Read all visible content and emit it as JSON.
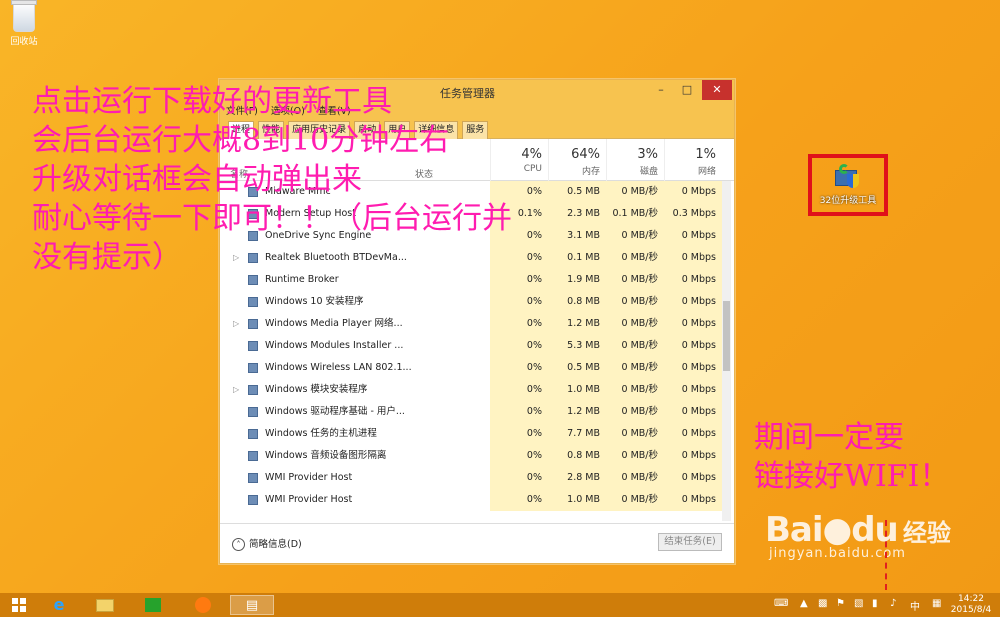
{
  "desktop": {
    "recycle_bin_label": "回收站",
    "updater_label": "32位升级工具"
  },
  "annotations": {
    "left_lines": [
      "点击运行下载好的更新工具",
      "会后台运行大概8到10分钟左右",
      "升级对话框会自动弹出来",
      "耐心等待一下即可！！（后台运行并",
      "没有提示）"
    ],
    "right_lines": [
      "期间一定要",
      "链接好WIFI！"
    ]
  },
  "task_manager": {
    "title": "任务管理器",
    "menu": [
      "文件(F)",
      "选项(O)",
      "查看(V)"
    ],
    "tabs": [
      "进程",
      "性能",
      "应用历史记录",
      "启动",
      "用户",
      "详细信息",
      "服务"
    ],
    "active_tab": "进程",
    "columns": {
      "name": "名称",
      "status": "状态",
      "cpu": {
        "pct": "4%",
        "label": "CPU"
      },
      "memory": {
        "pct": "64%",
        "label": "内存"
      },
      "disk": {
        "pct": "3%",
        "label": "磁盘"
      },
      "network": {
        "pct": "1%",
        "label": "网络"
      }
    },
    "processes": [
      {
        "name": "Midware Mmc",
        "expand": "",
        "cpu": "0%",
        "mem": "0.5 MB",
        "disk": "0 MB/秒",
        "net": "0 Mbps"
      },
      {
        "name": "Modern Setup Host",
        "expand": "",
        "cpu": "0.1%",
        "mem": "2.3 MB",
        "disk": "0.1 MB/秒",
        "net": "0.3 Mbps"
      },
      {
        "name": "OneDrive Sync Engine",
        "expand": "",
        "cpu": "0%",
        "mem": "3.1 MB",
        "disk": "0 MB/秒",
        "net": "0 Mbps"
      },
      {
        "name": "Realtek Bluetooth BTDevMa...",
        "expand": "▷",
        "cpu": "0%",
        "mem": "0.1 MB",
        "disk": "0 MB/秒",
        "net": "0 Mbps"
      },
      {
        "name": "Runtime Broker",
        "expand": "",
        "cpu": "0%",
        "mem": "1.9 MB",
        "disk": "0 MB/秒",
        "net": "0 Mbps"
      },
      {
        "name": "Windows 10 安装程序",
        "expand": "",
        "cpu": "0%",
        "mem": "0.8 MB",
        "disk": "0 MB/秒",
        "net": "0 Mbps"
      },
      {
        "name": "Windows Media Player 网络...",
        "expand": "▷",
        "cpu": "0%",
        "mem": "1.2 MB",
        "disk": "0 MB/秒",
        "net": "0 Mbps"
      },
      {
        "name": "Windows Modules Installer ...",
        "expand": "",
        "cpu": "0%",
        "mem": "5.3 MB",
        "disk": "0 MB/秒",
        "net": "0 Mbps"
      },
      {
        "name": "Windows Wireless LAN 802.1...",
        "expand": "",
        "cpu": "0%",
        "mem": "0.5 MB",
        "disk": "0 MB/秒",
        "net": "0 Mbps"
      },
      {
        "name": "Windows 模块安装程序",
        "expand": "▷",
        "cpu": "0%",
        "mem": "1.0 MB",
        "disk": "0 MB/秒",
        "net": "0 Mbps"
      },
      {
        "name": "Windows 驱动程序基础 - 用户...",
        "expand": "",
        "cpu": "0%",
        "mem": "1.2 MB",
        "disk": "0 MB/秒",
        "net": "0 Mbps"
      },
      {
        "name": "Windows 任务的主机进程",
        "expand": "",
        "cpu": "0%",
        "mem": "7.7 MB",
        "disk": "0 MB/秒",
        "net": "0 Mbps"
      },
      {
        "name": "Windows 音频设备图形隔离",
        "expand": "",
        "cpu": "0%",
        "mem": "0.8 MB",
        "disk": "0 MB/秒",
        "net": "0 Mbps"
      },
      {
        "name": "WMI Provider Host",
        "expand": "",
        "cpu": "0%",
        "mem": "2.8 MB",
        "disk": "0 MB/秒",
        "net": "0 Mbps"
      },
      {
        "name": "WMI Provider Host",
        "expand": "",
        "cpu": "0%",
        "mem": "1.0 MB",
        "disk": "0 MB/秒",
        "net": "0 Mbps"
      }
    ],
    "footer": {
      "less_details": "简略信息(D)",
      "end_task": "结束任务(E)"
    }
  },
  "watermark": {
    "brand": "Bai",
    "brand2": "du",
    "cn": "经验",
    "url": "jingyan.baidu.com"
  },
  "taskbar": {
    "ie_glyph": "e",
    "clock_time": "14:22",
    "clock_date": "2015/8/4",
    "ime": "中"
  }
}
